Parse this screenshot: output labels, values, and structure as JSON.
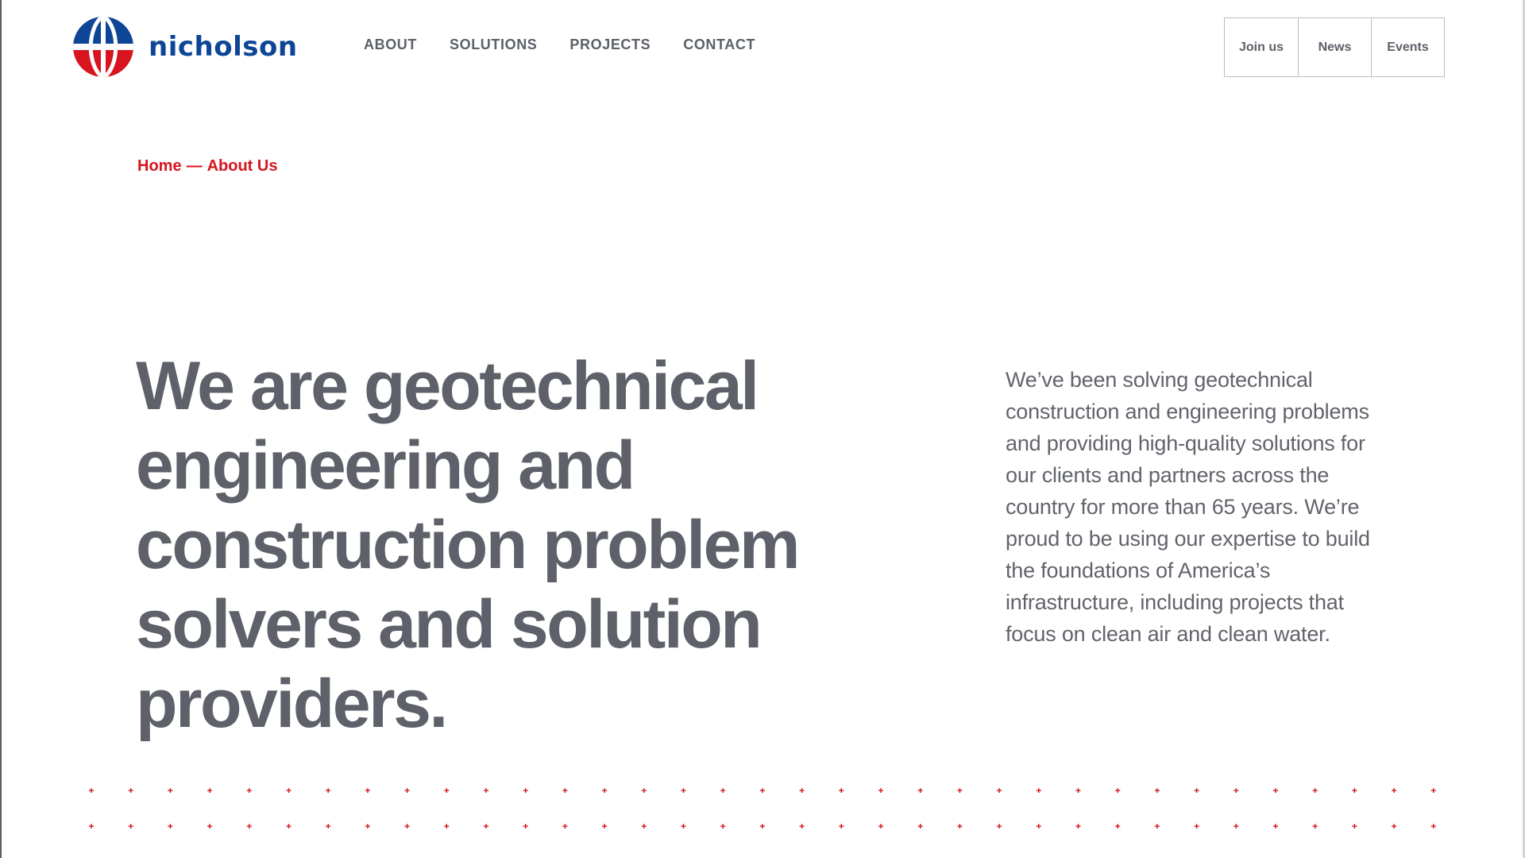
{
  "brand": {
    "name": "nicholson",
    "logo_icon": "globe-logo-icon",
    "colors": {
      "blue": "#0e4596",
      "red": "#d7141f",
      "gray": "#5e6169"
    }
  },
  "main_nav": [
    {
      "label": "ABOUT"
    },
    {
      "label": "SOLUTIONS"
    },
    {
      "label": "PROJECTS"
    },
    {
      "label": "CONTACT"
    }
  ],
  "utility_nav": [
    {
      "label": "Join us"
    },
    {
      "label": "News"
    },
    {
      "label": "Events"
    }
  ],
  "breadcrumb": {
    "home": "Home",
    "separator": "—",
    "current": "About Us"
  },
  "hero": {
    "headline": "We are geotechnical engineering and construction problem solvers and solution providers.",
    "intro": "We’ve been solving geotechnical construction and engineering problems and providing high-quality solutions for our clients and partners across the country for more than 65 years. We’re proud to be using our expertise to build the foundations of America’s infrastructure, including projects that focus on clean air and clean water."
  },
  "decoration": {
    "pattern_icon": "red-cross-pattern-icon"
  }
}
